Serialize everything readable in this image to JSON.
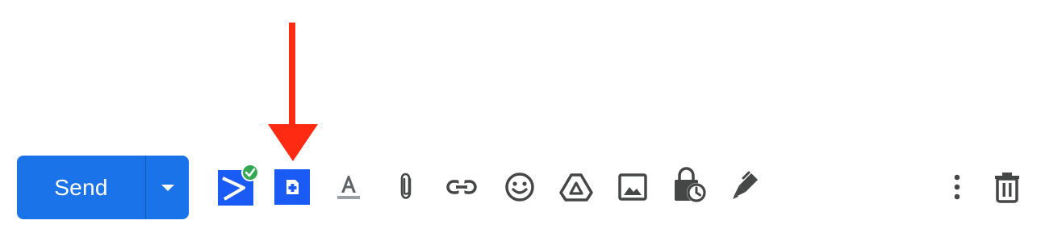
{
  "compose_toolbar": {
    "send_label": "Send",
    "send_options_icon": "chevron-down-icon",
    "icons": [
      "extension-badge-icon",
      "add-document-icon",
      "text-format-icon",
      "attach-file-icon",
      "insert-link-icon",
      "emoji-icon",
      "google-drive-icon",
      "insert-photo-icon",
      "confidential-mode-icon",
      "signature-icon",
      "more-options-icon",
      "discard-draft-icon"
    ]
  },
  "annotation": {
    "arrow_color": "#ff2a12",
    "points_to": "add-document-icon"
  },
  "colors": {
    "accent": "#1a73e8",
    "extension_blue": "#1a5bf5",
    "success_green": "#34a853",
    "icon_gray": "#444746"
  }
}
